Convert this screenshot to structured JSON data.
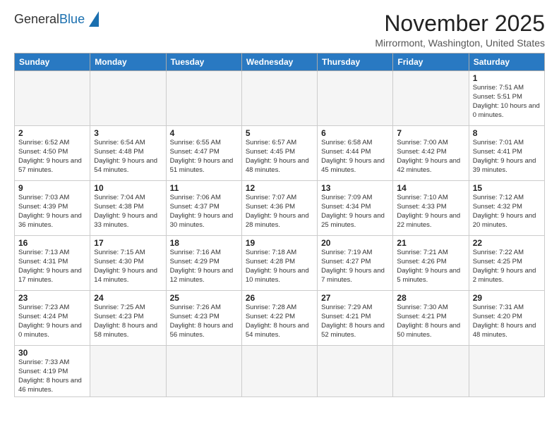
{
  "header": {
    "logo_general": "General",
    "logo_blue": "Blue",
    "month_title": "November 2025",
    "location": "Mirrormont, Washington, United States"
  },
  "weekdays": [
    "Sunday",
    "Monday",
    "Tuesday",
    "Wednesday",
    "Thursday",
    "Friday",
    "Saturday"
  ],
  "weeks": [
    [
      {
        "day": "",
        "info": ""
      },
      {
        "day": "",
        "info": ""
      },
      {
        "day": "",
        "info": ""
      },
      {
        "day": "",
        "info": ""
      },
      {
        "day": "",
        "info": ""
      },
      {
        "day": "",
        "info": ""
      },
      {
        "day": "1",
        "info": "Sunrise: 7:51 AM\nSunset: 5:51 PM\nDaylight: 10 hours and 0 minutes."
      }
    ],
    [
      {
        "day": "2",
        "info": "Sunrise: 6:52 AM\nSunset: 4:50 PM\nDaylight: 9 hours and 57 minutes."
      },
      {
        "day": "3",
        "info": "Sunrise: 6:54 AM\nSunset: 4:48 PM\nDaylight: 9 hours and 54 minutes."
      },
      {
        "day": "4",
        "info": "Sunrise: 6:55 AM\nSunset: 4:47 PM\nDaylight: 9 hours and 51 minutes."
      },
      {
        "day": "5",
        "info": "Sunrise: 6:57 AM\nSunset: 4:45 PM\nDaylight: 9 hours and 48 minutes."
      },
      {
        "day": "6",
        "info": "Sunrise: 6:58 AM\nSunset: 4:44 PM\nDaylight: 9 hours and 45 minutes."
      },
      {
        "day": "7",
        "info": "Sunrise: 7:00 AM\nSunset: 4:42 PM\nDaylight: 9 hours and 42 minutes."
      },
      {
        "day": "8",
        "info": "Sunrise: 7:01 AM\nSunset: 4:41 PM\nDaylight: 9 hours and 39 minutes."
      }
    ],
    [
      {
        "day": "9",
        "info": "Sunrise: 7:03 AM\nSunset: 4:39 PM\nDaylight: 9 hours and 36 minutes."
      },
      {
        "day": "10",
        "info": "Sunrise: 7:04 AM\nSunset: 4:38 PM\nDaylight: 9 hours and 33 minutes."
      },
      {
        "day": "11",
        "info": "Sunrise: 7:06 AM\nSunset: 4:37 PM\nDaylight: 9 hours and 30 minutes."
      },
      {
        "day": "12",
        "info": "Sunrise: 7:07 AM\nSunset: 4:36 PM\nDaylight: 9 hours and 28 minutes."
      },
      {
        "day": "13",
        "info": "Sunrise: 7:09 AM\nSunset: 4:34 PM\nDaylight: 9 hours and 25 minutes."
      },
      {
        "day": "14",
        "info": "Sunrise: 7:10 AM\nSunset: 4:33 PM\nDaylight: 9 hours and 22 minutes."
      },
      {
        "day": "15",
        "info": "Sunrise: 7:12 AM\nSunset: 4:32 PM\nDaylight: 9 hours and 20 minutes."
      }
    ],
    [
      {
        "day": "16",
        "info": "Sunrise: 7:13 AM\nSunset: 4:31 PM\nDaylight: 9 hours and 17 minutes."
      },
      {
        "day": "17",
        "info": "Sunrise: 7:15 AM\nSunset: 4:30 PM\nDaylight: 9 hours and 14 minutes."
      },
      {
        "day": "18",
        "info": "Sunrise: 7:16 AM\nSunset: 4:29 PM\nDaylight: 9 hours and 12 minutes."
      },
      {
        "day": "19",
        "info": "Sunrise: 7:18 AM\nSunset: 4:28 PM\nDaylight: 9 hours and 10 minutes."
      },
      {
        "day": "20",
        "info": "Sunrise: 7:19 AM\nSunset: 4:27 PM\nDaylight: 9 hours and 7 minutes."
      },
      {
        "day": "21",
        "info": "Sunrise: 7:21 AM\nSunset: 4:26 PM\nDaylight: 9 hours and 5 minutes."
      },
      {
        "day": "22",
        "info": "Sunrise: 7:22 AM\nSunset: 4:25 PM\nDaylight: 9 hours and 2 minutes."
      }
    ],
    [
      {
        "day": "23",
        "info": "Sunrise: 7:23 AM\nSunset: 4:24 PM\nDaylight: 9 hours and 0 minutes."
      },
      {
        "day": "24",
        "info": "Sunrise: 7:25 AM\nSunset: 4:23 PM\nDaylight: 8 hours and 58 minutes."
      },
      {
        "day": "25",
        "info": "Sunrise: 7:26 AM\nSunset: 4:23 PM\nDaylight: 8 hours and 56 minutes."
      },
      {
        "day": "26",
        "info": "Sunrise: 7:28 AM\nSunset: 4:22 PM\nDaylight: 8 hours and 54 minutes."
      },
      {
        "day": "27",
        "info": "Sunrise: 7:29 AM\nSunset: 4:21 PM\nDaylight: 8 hours and 52 minutes."
      },
      {
        "day": "28",
        "info": "Sunrise: 7:30 AM\nSunset: 4:21 PM\nDaylight: 8 hours and 50 minutes."
      },
      {
        "day": "29",
        "info": "Sunrise: 7:31 AM\nSunset: 4:20 PM\nDaylight: 8 hours and 48 minutes."
      }
    ],
    [
      {
        "day": "30",
        "info": "Sunrise: 7:33 AM\nSunset: 4:19 PM\nDaylight: 8 hours and 46 minutes."
      },
      {
        "day": "",
        "info": ""
      },
      {
        "day": "",
        "info": ""
      },
      {
        "day": "",
        "info": ""
      },
      {
        "day": "",
        "info": ""
      },
      {
        "day": "",
        "info": ""
      },
      {
        "day": "",
        "info": ""
      }
    ]
  ]
}
